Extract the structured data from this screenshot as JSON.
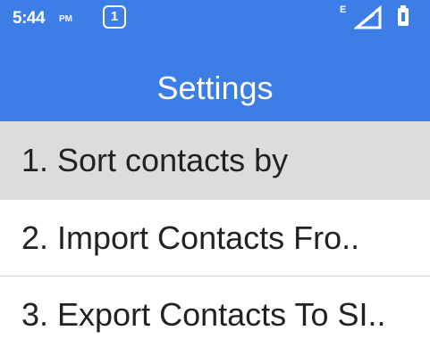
{
  "status_bar": {
    "time": "5:44",
    "ampm": "PM",
    "sim_slot": "1",
    "network_type": "E",
    "signal_icon": "signal-icon",
    "battery_icon": "battery-icon",
    "icon_color": "#ffffff"
  },
  "header": {
    "title": "Settings",
    "background_color": "#3d7de6"
  },
  "menu": {
    "selected_index": 0,
    "selected_background": "#dcdcdc",
    "items": [
      {
        "label": "1. Sort contacts by"
      },
      {
        "label": "2. Import Contacts Fro.."
      },
      {
        "label": "3. Export Contacts To SI.."
      }
    ]
  }
}
